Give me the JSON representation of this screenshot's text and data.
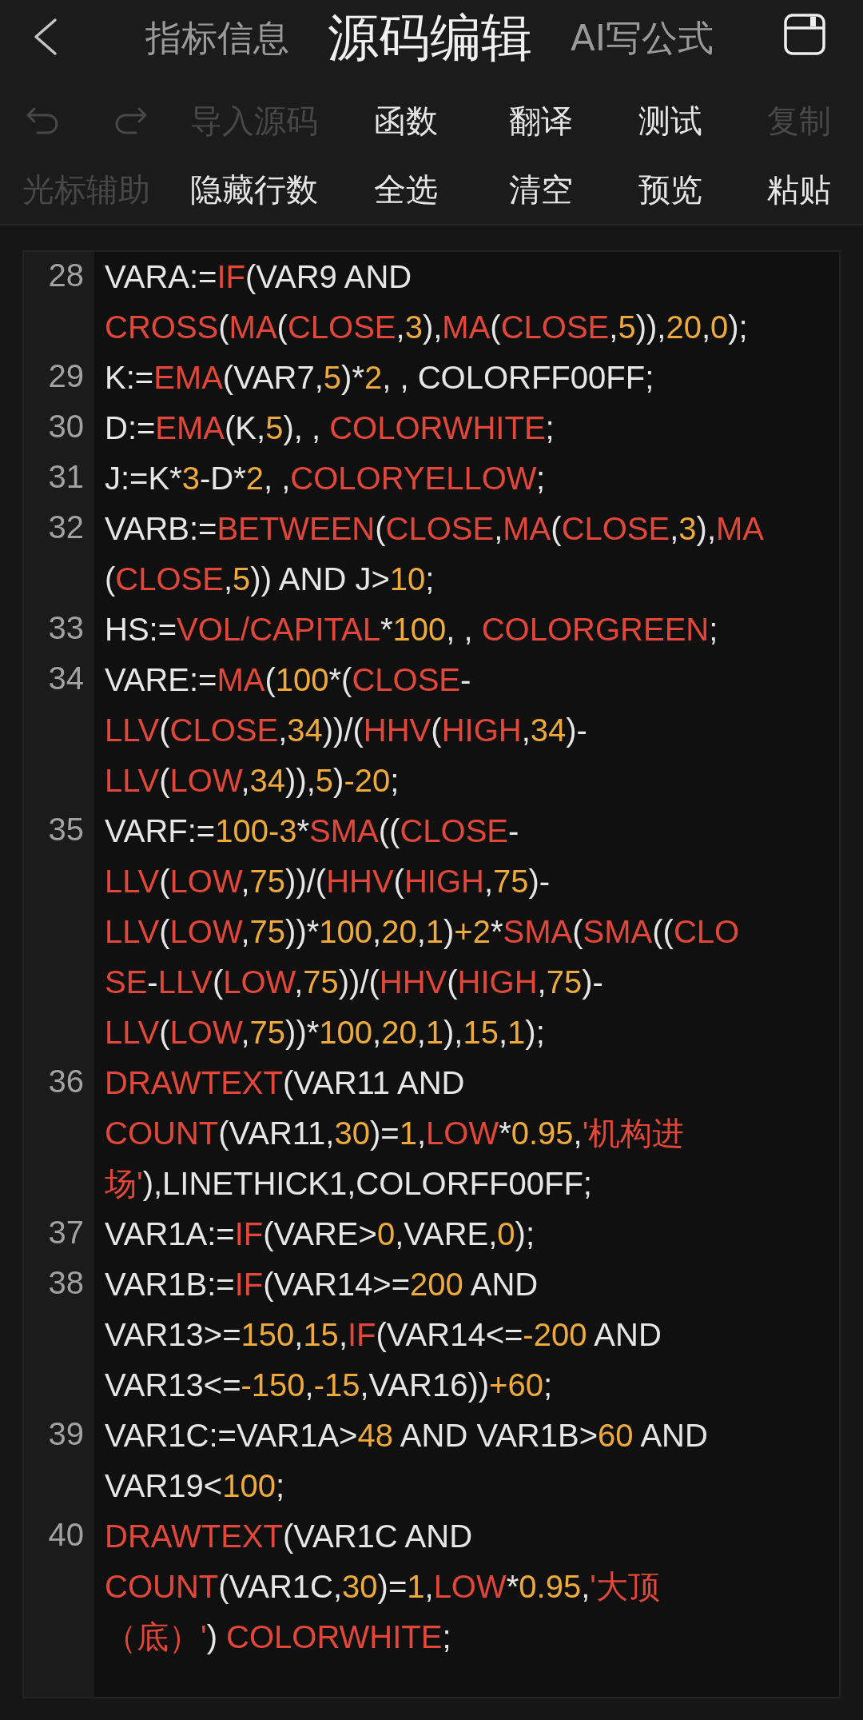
{
  "header": {
    "tabs": [
      {
        "label": "指标信息",
        "selected": false
      },
      {
        "label": "源码编辑",
        "selected": true
      },
      {
        "label": "AI写公式",
        "selected": false
      }
    ]
  },
  "toolbar": {
    "undo": {
      "disabled": true
    },
    "redo": {
      "disabled": true
    },
    "rows": [
      {
        "buttons": [
          {
            "label": "导入源码",
            "disabled": true
          },
          {
            "label": "函数",
            "disabled": false
          },
          {
            "label": "翻译",
            "disabled": false
          },
          {
            "label": "测试",
            "disabled": false
          },
          {
            "label": "复制",
            "disabled": true
          }
        ]
      },
      {
        "buttons": [
          {
            "label": "光标辅助",
            "disabled": true
          },
          {
            "label": "隐藏行数",
            "disabled": false
          },
          {
            "label": "全选",
            "disabled": false
          },
          {
            "label": "清空",
            "disabled": false
          },
          {
            "label": "预览",
            "disabled": false
          },
          {
            "label": "粘贴",
            "disabled": false
          }
        ]
      }
    ]
  },
  "editor": {
    "lines": [
      {
        "number": "28",
        "rows": [
          {
            "segments": [
              {
                "kind": "plain",
                "text": "VARA:="
              },
              {
                "kind": "function",
                "text": "IF"
              },
              {
                "kind": "plain",
                "text": "(VAR9 AND"
              }
            ]
          },
          {
            "segments": [
              {
                "kind": "function",
                "text": "CROSS"
              },
              {
                "kind": "plain",
                "text": "("
              },
              {
                "kind": "function",
                "text": "MA"
              },
              {
                "kind": "plain",
                "text": "("
              },
              {
                "kind": "function",
                "text": "CLOSE"
              },
              {
                "kind": "plain",
                "text": ","
              },
              {
                "kind": "number",
                "text": "3"
              },
              {
                "kind": "plain",
                "text": "),"
              },
              {
                "kind": "function",
                "text": "MA"
              },
              {
                "kind": "plain",
                "text": "("
              },
              {
                "kind": "function",
                "text": "CLOSE"
              },
              {
                "kind": "plain",
                "text": ","
              },
              {
                "kind": "number",
                "text": "5"
              },
              {
                "kind": "plain",
                "text": ")),"
              },
              {
                "kind": "number",
                "text": "20"
              },
              {
                "kind": "plain",
                "text": ","
              },
              {
                "kind": "number",
                "text": "0"
              },
              {
                "kind": "plain",
                "text": ");"
              }
            ]
          }
        ]
      },
      {
        "number": "29",
        "rows": [
          {
            "segments": [
              {
                "kind": "plain",
                "text": "K:="
              },
              {
                "kind": "function",
                "text": "EMA"
              },
              {
                "kind": "plain",
                "text": "(VAR7,"
              },
              {
                "kind": "number",
                "text": "5"
              },
              {
                "kind": "plain",
                "text": ")*"
              },
              {
                "kind": "number",
                "text": "2"
              },
              {
                "kind": "plain",
                "text": ", , COLORFF00FF;"
              }
            ]
          }
        ]
      },
      {
        "number": "30",
        "rows": [
          {
            "segments": [
              {
                "kind": "plain",
                "text": "D:="
              },
              {
                "kind": "function",
                "text": "EMA"
              },
              {
                "kind": "plain",
                "text": "(K,"
              },
              {
                "kind": "number",
                "text": "5"
              },
              {
                "kind": "plain",
                "text": "), , "
              },
              {
                "kind": "function",
                "text": "COLORWHITE"
              },
              {
                "kind": "plain",
                "text": ";"
              }
            ]
          }
        ]
      },
      {
        "number": "31",
        "rows": [
          {
            "segments": [
              {
                "kind": "plain",
                "text": "J:=K*"
              },
              {
                "kind": "number",
                "text": "3"
              },
              {
                "kind": "plain",
                "text": "-D*"
              },
              {
                "kind": "number",
                "text": "2"
              },
              {
                "kind": "plain",
                "text": ", ,"
              },
              {
                "kind": "function",
                "text": "COLORYELLOW"
              },
              {
                "kind": "plain",
                "text": ";"
              }
            ]
          }
        ]
      },
      {
        "number": "32",
        "rows": [
          {
            "segments": [
              {
                "kind": "plain",
                "text": "VARB:="
              },
              {
                "kind": "function",
                "text": "BETWEEN"
              },
              {
                "kind": "plain",
                "text": "("
              },
              {
                "kind": "function",
                "text": "CLOSE"
              },
              {
                "kind": "plain",
                "text": ","
              },
              {
                "kind": "function",
                "text": "MA"
              },
              {
                "kind": "plain",
                "text": "("
              },
              {
                "kind": "function",
                "text": "CLOSE"
              },
              {
                "kind": "plain",
                "text": ","
              },
              {
                "kind": "number",
                "text": "3"
              },
              {
                "kind": "plain",
                "text": "),"
              },
              {
                "kind": "function",
                "text": "MA"
              }
            ]
          },
          {
            "segments": [
              {
                "kind": "plain",
                "text": "("
              },
              {
                "kind": "function",
                "text": "CLOSE"
              },
              {
                "kind": "plain",
                "text": ","
              },
              {
                "kind": "number",
                "text": "5"
              },
              {
                "kind": "plain",
                "text": ")) AND J>"
              },
              {
                "kind": "number",
                "text": "10"
              },
              {
                "kind": "plain",
                "text": ";"
              }
            ]
          }
        ]
      },
      {
        "number": "33",
        "rows": [
          {
            "segments": [
              {
                "kind": "plain",
                "text": "HS:="
              },
              {
                "kind": "function",
                "text": "VOL/CAPITAL"
              },
              {
                "kind": "plain",
                "text": "*"
              },
              {
                "kind": "number",
                "text": "100"
              },
              {
                "kind": "plain",
                "text": ", , "
              },
              {
                "kind": "function",
                "text": "COLORGREEN"
              },
              {
                "kind": "plain",
                "text": ";"
              }
            ]
          }
        ]
      },
      {
        "number": "34",
        "rows": [
          {
            "segments": [
              {
                "kind": "plain",
                "text": "VARE:="
              },
              {
                "kind": "function",
                "text": "MA"
              },
              {
                "kind": "plain",
                "text": "("
              },
              {
                "kind": "number",
                "text": "100"
              },
              {
                "kind": "plain",
                "text": "*("
              },
              {
                "kind": "function",
                "text": "CLOSE"
              },
              {
                "kind": "plain",
                "text": "-"
              }
            ]
          },
          {
            "segments": [
              {
                "kind": "function",
                "text": "LLV"
              },
              {
                "kind": "plain",
                "text": "("
              },
              {
                "kind": "function",
                "text": "CLOSE"
              },
              {
                "kind": "plain",
                "text": ","
              },
              {
                "kind": "number",
                "text": "34"
              },
              {
                "kind": "plain",
                "text": "))/("
              },
              {
                "kind": "function",
                "text": "HHV"
              },
              {
                "kind": "plain",
                "text": "("
              },
              {
                "kind": "function",
                "text": "HIGH"
              },
              {
                "kind": "plain",
                "text": ","
              },
              {
                "kind": "number",
                "text": "34"
              },
              {
                "kind": "plain",
                "text": ")-"
              }
            ]
          },
          {
            "segments": [
              {
                "kind": "function",
                "text": "LLV"
              },
              {
                "kind": "plain",
                "text": "("
              },
              {
                "kind": "function",
                "text": "LOW"
              },
              {
                "kind": "plain",
                "text": ","
              },
              {
                "kind": "number",
                "text": "34"
              },
              {
                "kind": "plain",
                "text": ")),"
              },
              {
                "kind": "number",
                "text": "5"
              },
              {
                "kind": "plain",
                "text": ")"
              },
              {
                "kind": "number",
                "text": "-20"
              },
              {
                "kind": "plain",
                "text": ";"
              }
            ]
          }
        ]
      },
      {
        "number": "35",
        "rows": [
          {
            "segments": [
              {
                "kind": "plain",
                "text": "VARF:="
              },
              {
                "kind": "number",
                "text": "100-3"
              },
              {
                "kind": "plain",
                "text": "*"
              },
              {
                "kind": "function",
                "text": "SMA"
              },
              {
                "kind": "plain",
                "text": "(("
              },
              {
                "kind": "function",
                "text": "CLOSE"
              },
              {
                "kind": "plain",
                "text": "-"
              }
            ]
          },
          {
            "segments": [
              {
                "kind": "function",
                "text": "LLV"
              },
              {
                "kind": "plain",
                "text": "("
              },
              {
                "kind": "function",
                "text": "LOW"
              },
              {
                "kind": "plain",
                "text": ","
              },
              {
                "kind": "number",
                "text": "75"
              },
              {
                "kind": "plain",
                "text": "))/("
              },
              {
                "kind": "function",
                "text": "HHV"
              },
              {
                "kind": "plain",
                "text": "("
              },
              {
                "kind": "function",
                "text": "HIGH"
              },
              {
                "kind": "plain",
                "text": ","
              },
              {
                "kind": "number",
                "text": "75"
              },
              {
                "kind": "plain",
                "text": ")-"
              }
            ]
          },
          {
            "segments": [
              {
                "kind": "function",
                "text": "LLV"
              },
              {
                "kind": "plain",
                "text": "("
              },
              {
                "kind": "function",
                "text": "LOW"
              },
              {
                "kind": "plain",
                "text": ","
              },
              {
                "kind": "number",
                "text": "75"
              },
              {
                "kind": "plain",
                "text": "))*"
              },
              {
                "kind": "number",
                "text": "100"
              },
              {
                "kind": "plain",
                "text": ","
              },
              {
                "kind": "number",
                "text": "20"
              },
              {
                "kind": "plain",
                "text": ","
              },
              {
                "kind": "number",
                "text": "1"
              },
              {
                "kind": "plain",
                "text": ")"
              },
              {
                "kind": "number",
                "text": "+2"
              },
              {
                "kind": "plain",
                "text": "*"
              },
              {
                "kind": "function",
                "text": "SMA"
              },
              {
                "kind": "plain",
                "text": "("
              },
              {
                "kind": "function",
                "text": "SMA"
              },
              {
                "kind": "plain",
                "text": "(("
              },
              {
                "kind": "function",
                "text": "CLO"
              }
            ]
          },
          {
            "segments": [
              {
                "kind": "function",
                "text": "SE"
              },
              {
                "kind": "plain",
                "text": "-"
              },
              {
                "kind": "function",
                "text": "LLV"
              },
              {
                "kind": "plain",
                "text": "("
              },
              {
                "kind": "function",
                "text": "LOW"
              },
              {
                "kind": "plain",
                "text": ","
              },
              {
                "kind": "number",
                "text": "75"
              },
              {
                "kind": "plain",
                "text": "))/("
              },
              {
                "kind": "function",
                "text": "HHV"
              },
              {
                "kind": "plain",
                "text": "("
              },
              {
                "kind": "function",
                "text": "HIGH"
              },
              {
                "kind": "plain",
                "text": ","
              },
              {
                "kind": "number",
                "text": "75"
              },
              {
                "kind": "plain",
                "text": ")-"
              }
            ]
          },
          {
            "segments": [
              {
                "kind": "function",
                "text": "LLV"
              },
              {
                "kind": "plain",
                "text": "("
              },
              {
                "kind": "function",
                "text": "LOW"
              },
              {
                "kind": "plain",
                "text": ","
              },
              {
                "kind": "number",
                "text": "75"
              },
              {
                "kind": "plain",
                "text": "))*"
              },
              {
                "kind": "number",
                "text": "100"
              },
              {
                "kind": "plain",
                "text": ","
              },
              {
                "kind": "number",
                "text": "20"
              },
              {
                "kind": "plain",
                "text": ","
              },
              {
                "kind": "number",
                "text": "1"
              },
              {
                "kind": "plain",
                "text": "),"
              },
              {
                "kind": "number",
                "text": "15"
              },
              {
                "kind": "plain",
                "text": ","
              },
              {
                "kind": "number",
                "text": "1"
              },
              {
                "kind": "plain",
                "text": ");"
              }
            ]
          }
        ]
      },
      {
        "number": "36",
        "rows": [
          {
            "segments": [
              {
                "kind": "function",
                "text": "DRAWTEXT"
              },
              {
                "kind": "plain",
                "text": "(VAR11 AND"
              }
            ]
          },
          {
            "segments": [
              {
                "kind": "function",
                "text": "COUNT"
              },
              {
                "kind": "plain",
                "text": "(VAR11,"
              },
              {
                "kind": "number",
                "text": "30"
              },
              {
                "kind": "plain",
                "text": ")="
              },
              {
                "kind": "number",
                "text": "1"
              },
              {
                "kind": "plain",
                "text": ","
              },
              {
                "kind": "function",
                "text": "LOW"
              },
              {
                "kind": "plain",
                "text": "*"
              },
              {
                "kind": "number",
                "text": "0.95"
              },
              {
                "kind": "plain",
                "text": ","
              },
              {
                "kind": "string",
                "text": "'机构进"
              }
            ]
          },
          {
            "segments": [
              {
                "kind": "string",
                "text": "场'"
              },
              {
                "kind": "plain",
                "text": "),LINETHICK1,COLORFF00FF;"
              }
            ]
          }
        ]
      },
      {
        "number": "37",
        "rows": [
          {
            "segments": [
              {
                "kind": "plain",
                "text": "VAR1A:="
              },
              {
                "kind": "function",
                "text": "IF"
              },
              {
                "kind": "plain",
                "text": "(VARE>"
              },
              {
                "kind": "number",
                "text": "0"
              },
              {
                "kind": "plain",
                "text": ",VARE,"
              },
              {
                "kind": "number",
                "text": "0"
              },
              {
                "kind": "plain",
                "text": ");"
              }
            ]
          }
        ]
      },
      {
        "number": "38",
        "rows": [
          {
            "segments": [
              {
                "kind": "plain",
                "text": "VAR1B:="
              },
              {
                "kind": "function",
                "text": "IF"
              },
              {
                "kind": "plain",
                "text": "(VAR14>="
              },
              {
                "kind": "number",
                "text": "200"
              },
              {
                "kind": "plain",
                "text": " AND"
              }
            ]
          },
          {
            "segments": [
              {
                "kind": "plain",
                "text": "VAR13>="
              },
              {
                "kind": "number",
                "text": "150"
              },
              {
                "kind": "plain",
                "text": ","
              },
              {
                "kind": "number",
                "text": "15"
              },
              {
                "kind": "plain",
                "text": ","
              },
              {
                "kind": "function",
                "text": "IF"
              },
              {
                "kind": "plain",
                "text": "(VAR14<="
              },
              {
                "kind": "number",
                "text": "-200"
              },
              {
                "kind": "plain",
                "text": " AND"
              }
            ]
          },
          {
            "segments": [
              {
                "kind": "plain",
                "text": "VAR13<="
              },
              {
                "kind": "number",
                "text": "-150"
              },
              {
                "kind": "plain",
                "text": ","
              },
              {
                "kind": "number",
                "text": "-15"
              },
              {
                "kind": "plain",
                "text": ",VAR16))"
              },
              {
                "kind": "number",
                "text": "+60"
              },
              {
                "kind": "plain",
                "text": ";"
              }
            ]
          }
        ]
      },
      {
        "number": "39",
        "rows": [
          {
            "segments": [
              {
                "kind": "plain",
                "text": "VAR1C:=VAR1A>"
              },
              {
                "kind": "number",
                "text": "48"
              },
              {
                "kind": "plain",
                "text": " AND VAR1B>"
              },
              {
                "kind": "number",
                "text": "60"
              },
              {
                "kind": "plain",
                "text": " AND"
              }
            ]
          },
          {
            "segments": [
              {
                "kind": "plain",
                "text": "VAR19<"
              },
              {
                "kind": "number",
                "text": "100"
              },
              {
                "kind": "plain",
                "text": ";"
              }
            ]
          }
        ]
      },
      {
        "number": "40",
        "rows": [
          {
            "segments": [
              {
                "kind": "function",
                "text": "DRAWTEXT"
              },
              {
                "kind": "plain",
                "text": "(VAR1C AND"
              }
            ]
          },
          {
            "segments": [
              {
                "kind": "function",
                "text": "COUNT"
              },
              {
                "kind": "plain",
                "text": "(VAR1C,"
              },
              {
                "kind": "number",
                "text": "30"
              },
              {
                "kind": "plain",
                "text": ")="
              },
              {
                "kind": "number",
                "text": "1"
              },
              {
                "kind": "plain",
                "text": ","
              },
              {
                "kind": "function",
                "text": "LOW"
              },
              {
                "kind": "plain",
                "text": "*"
              },
              {
                "kind": "number",
                "text": "0.95"
              },
              {
                "kind": "plain",
                "text": ","
              },
              {
                "kind": "string",
                "text": "'大顶"
              }
            ]
          },
          {
            "segments": [
              {
                "kind": "string",
                "text": "（底）'"
              },
              {
                "kind": "plain",
                "text": ") "
              },
              {
                "kind": "function",
                "text": "COLORWHITE"
              },
              {
                "kind": "plain",
                "text": ";"
              }
            ]
          }
        ]
      }
    ]
  }
}
